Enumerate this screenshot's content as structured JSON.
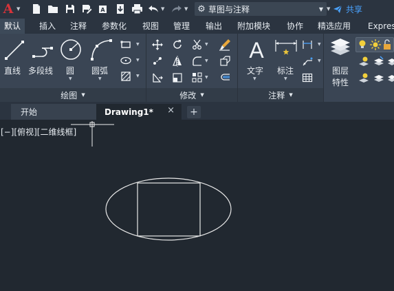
{
  "app": {
    "logo_letter": "A"
  },
  "toolbar": {
    "workspace": "草图与注释",
    "share": "共享"
  },
  "ribbon_tabs": [
    "默认",
    "插入",
    "注释",
    "参数化",
    "视图",
    "管理",
    "输出",
    "附加模块",
    "协作",
    "精选应用",
    "Express"
  ],
  "draw_panel": {
    "line": "直线",
    "polyline": "多段线",
    "circle": "圆",
    "arc": "圆弧",
    "footer": "绘图"
  },
  "modify_panel": {
    "footer": "修改"
  },
  "annotation_panel": {
    "text": "文字",
    "dimension": "标注",
    "footer": "注释"
  },
  "layers_panel": {
    "label_line1": "图层",
    "label_line2": "特性"
  },
  "doc_tabs": {
    "start": "开始",
    "drawing": "Drawing1*",
    "close": "×",
    "add": "+"
  },
  "viewport": {
    "label": "[−][俯视][二维线框]"
  },
  "colors": {
    "accent_blue": "#4aa3ff",
    "logo_red": "#d6333a",
    "canvas_bg": "#212830",
    "ribbon_bg": "#3a4554",
    "entity_white": "#e8e8e8"
  },
  "drawing": {
    "entities": [
      "ellipse",
      "rectangle"
    ],
    "crosshair": true
  }
}
